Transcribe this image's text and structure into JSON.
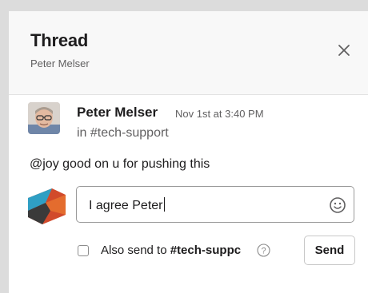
{
  "header": {
    "title": "Thread",
    "subtitle": "Peter Melser",
    "close_icon": "close-icon"
  },
  "message": {
    "author": "Peter Melser",
    "time": "Nov 1st at 3:40 PM",
    "channel": "in #tech-support",
    "text": "@joy good on u for pushing this",
    "avatar_icon": "user-avatar"
  },
  "reply": {
    "input_value": "I agree Peter",
    "emoji_icon": "emoji-icon",
    "also_send_prefix": "Also send to ",
    "also_send_channel": "#tech-suppc",
    "help_icon": "help-icon",
    "send_label": "Send",
    "checkbox_checked": false
  },
  "colors": {
    "panel_bg": "#f8f8f8",
    "text": "#1d1c1d",
    "muted": "#616061"
  }
}
